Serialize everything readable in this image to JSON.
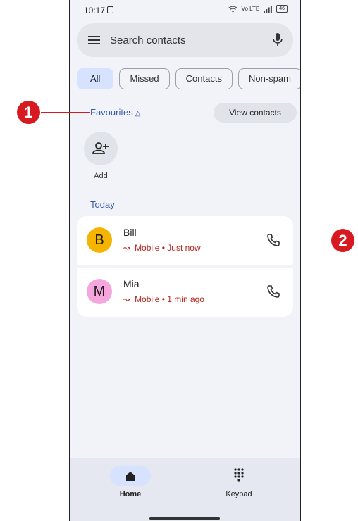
{
  "status_bar": {
    "time": "10:17",
    "network": "Vo LTE",
    "battery": "46"
  },
  "search": {
    "placeholder": "Search contacts"
  },
  "filters": [
    "All",
    "Missed",
    "Contacts",
    "Non-spam"
  ],
  "favourites": {
    "title": "Favourites",
    "view_contacts": "View contacts",
    "add_label": "Add"
  },
  "section": {
    "today": "Today"
  },
  "calls": [
    {
      "initial": "B",
      "name": "Bill",
      "detail": "Mobile • Just now",
      "avatar_color": "#f4b400"
    },
    {
      "initial": "M",
      "name": "Mia",
      "detail": "Mobile • 1 min ago",
      "avatar_color": "#f5a7dd"
    }
  ],
  "nav": {
    "home": "Home",
    "keypad": "Keypad"
  },
  "callouts": [
    "1",
    "2"
  ],
  "colors": {
    "accent": "#3b5aa6",
    "missed": "#b3261e",
    "callout": "#d71920"
  }
}
